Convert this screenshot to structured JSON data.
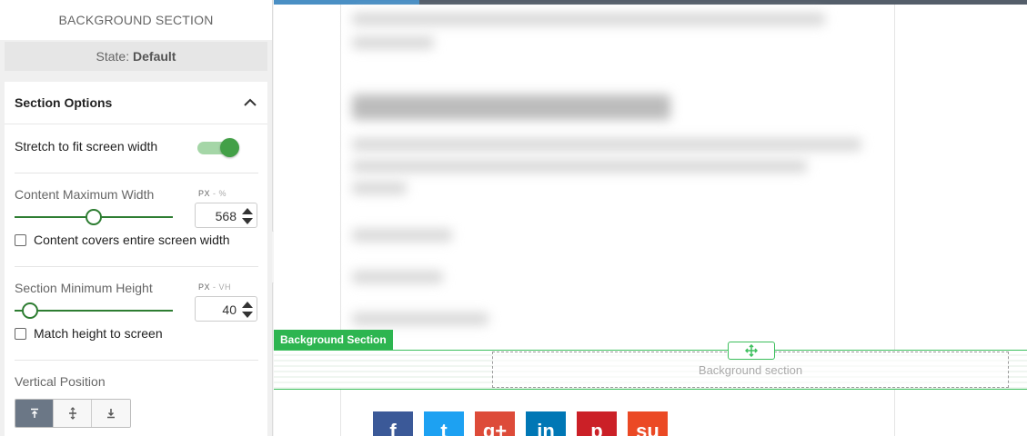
{
  "sidebar": {
    "title": "BACKGROUND SECTION",
    "state_label": "State:",
    "state_value": "Default",
    "section_options": {
      "title": "Section Options",
      "stretch_label": "Stretch to fit screen width",
      "stretch_on": true,
      "content_max_width": {
        "label": "Content Maximum Width",
        "unit_primary": "PX",
        "unit_sep": " - ",
        "unit_secondary": "%",
        "value": "568",
        "slider_fraction": 0.5
      },
      "cover_label": "Content covers entire screen width",
      "section_min_height": {
        "label": "Section Minimum Height",
        "unit_primary": "PX",
        "unit_sep": " - ",
        "unit_secondary": "VH",
        "value": "40",
        "slider_fraction": 0.05
      },
      "match_height_label": "Match height to screen",
      "vertical_position": {
        "label": "Vertical Position",
        "options": [
          "top-align-icon",
          "center-align-icon",
          "bottom-align-icon"
        ],
        "active": 0
      }
    }
  },
  "canvas": {
    "section_tag": "Background Section",
    "placeholder": "Background section",
    "social_buttons": [
      {
        "name": "facebook-icon",
        "glyph": "f",
        "color": "#3b5998"
      },
      {
        "name": "twitter-icon",
        "glyph": "t",
        "color": "#1da1f2"
      },
      {
        "name": "google-plus-icon",
        "glyph": "g+",
        "color": "#dd4b39"
      },
      {
        "name": "linkedin-icon",
        "glyph": "in",
        "color": "#0077b5"
      },
      {
        "name": "pinterest-icon",
        "glyph": "p",
        "color": "#cb2027"
      },
      {
        "name": "stumbleupon-icon",
        "glyph": "su",
        "color": "#eb4924"
      }
    ]
  },
  "colors": {
    "accent_green": "#3cbf5c",
    "topbar": "#545e6a",
    "topbar_accent": "#4a8fc4"
  }
}
